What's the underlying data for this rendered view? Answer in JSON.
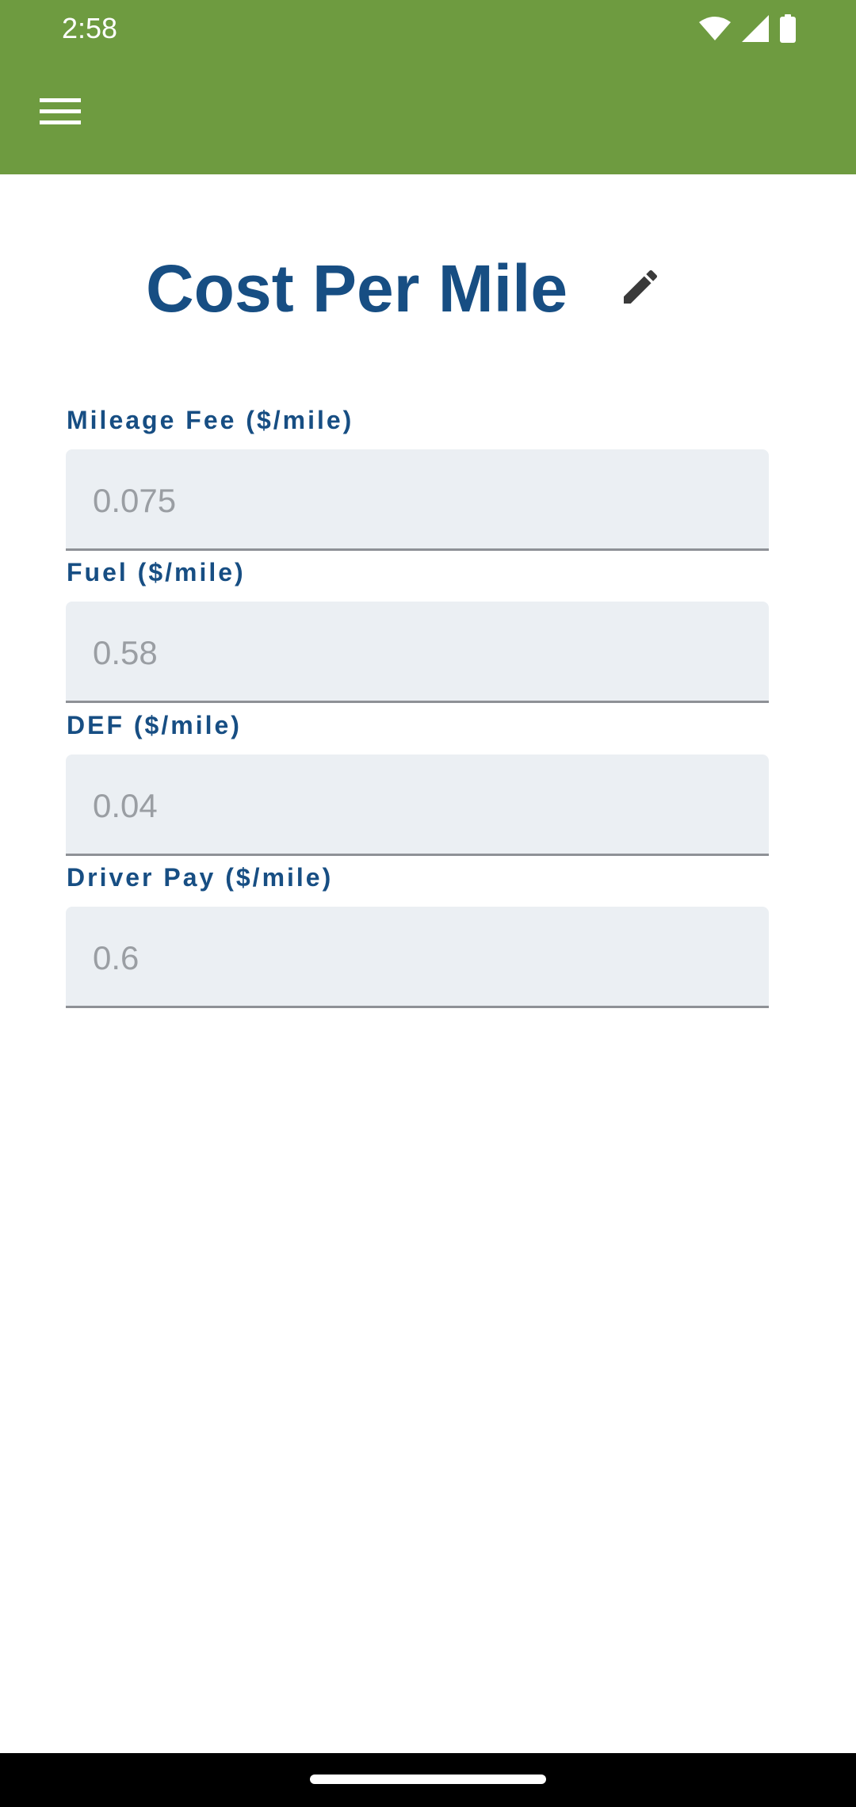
{
  "status_bar": {
    "time": "2:58",
    "icons": [
      "wifi-icon",
      "signal-icon",
      "battery-icon"
    ]
  },
  "app_bar": {
    "color": "#6e9b40",
    "menu_icon": "hamburger-menu-icon"
  },
  "page": {
    "title": "Cost Per Mile",
    "title_color": "#174e83",
    "edit_icon": "pencil-icon"
  },
  "fields": [
    {
      "label": "Mileage Fee ($/mile)",
      "value": "0.075"
    },
    {
      "label": "Fuel ($/mile)",
      "value": "0.58"
    },
    {
      "label": "DEF ($/mile)",
      "value": "0.04"
    },
    {
      "label": "Driver Pay ($/mile)",
      "value": "0.6"
    }
  ]
}
